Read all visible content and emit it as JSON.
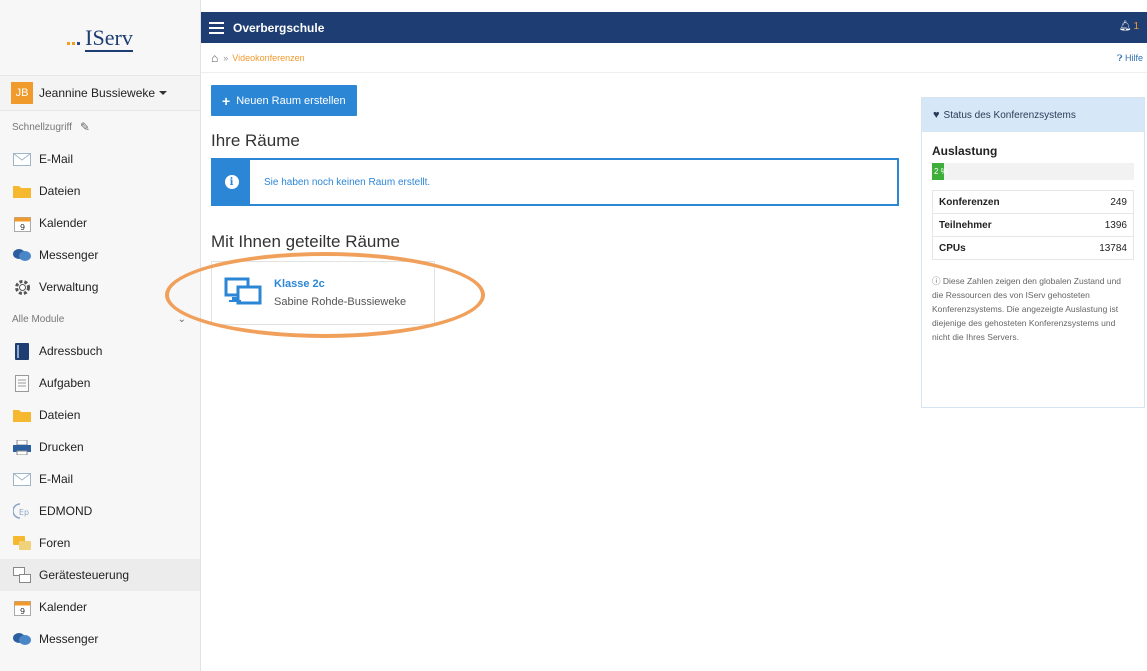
{
  "logo": {
    "text": "IServ"
  },
  "user": {
    "initials": "JB",
    "name": "Jeannine Bussieweke"
  },
  "sidebar": {
    "quick_label": "Schnellzugriff",
    "quick_items": [
      {
        "label": "E-Mail",
        "icon": "mail-icon"
      },
      {
        "label": "Dateien",
        "icon": "folder-icon"
      },
      {
        "label": "Kalender",
        "icon": "calendar-icon"
      },
      {
        "label": "Messenger",
        "icon": "chat-icon"
      },
      {
        "label": "Verwaltung",
        "icon": "gear-icon"
      }
    ],
    "modules_label": "Alle Module",
    "module_items": [
      {
        "label": "Adressbuch",
        "icon": "addressbook-icon"
      },
      {
        "label": "Aufgaben",
        "icon": "tasks-icon"
      },
      {
        "label": "Dateien",
        "icon": "folder-icon"
      },
      {
        "label": "Drucken",
        "icon": "printer-icon"
      },
      {
        "label": "E-Mail",
        "icon": "mail-icon"
      },
      {
        "label": "EDMOND",
        "icon": "edmond-icon"
      },
      {
        "label": "Foren",
        "icon": "forum-icon"
      },
      {
        "label": "Gerätesteuerung",
        "icon": "devices-icon"
      },
      {
        "label": "Kalender",
        "icon": "calendar-icon"
      },
      {
        "label": "Messenger",
        "icon": "chat-icon"
      }
    ]
  },
  "header": {
    "title": "Overbergschule",
    "notification_count": "1"
  },
  "breadcrumb": {
    "current": "Videokonferenzen",
    "help": "Hilfe"
  },
  "main": {
    "new_room_button": "Neuen Raum erstellen",
    "my_rooms_heading": "Ihre Räume",
    "no_rooms_message": "Sie haben noch keinen Raum erstellt.",
    "shared_heading": "Mit Ihnen geteilte Räume",
    "shared_room": {
      "title": "Klasse 2c",
      "owner": "Sabine Rohde-Bussieweke"
    }
  },
  "status": {
    "heading": "Status des Konferenzsystems",
    "load_label": "Auslastung",
    "load_value": "2 %",
    "load_fraction": 0.02,
    "rows": [
      {
        "label": "Konferenzen",
        "value": "249"
      },
      {
        "label": "Teilnehmer",
        "value": "1396"
      },
      {
        "label": "CPUs",
        "value": "13784"
      }
    ],
    "note": "Diese Zahlen zeigen den globalen Zustand und die Ressourcen des von IServ gehosteten Konferenzsystems. Die angezeigte Auslastung ist diejenige des gehosteten Konferenzsystems und nicht die Ihres Servers."
  },
  "colors": {
    "brand": "#1e3d73",
    "accent": "#2c86d6",
    "orange": "#f19a2c",
    "success": "#3dae3a",
    "highlight": "#f0a05a"
  }
}
